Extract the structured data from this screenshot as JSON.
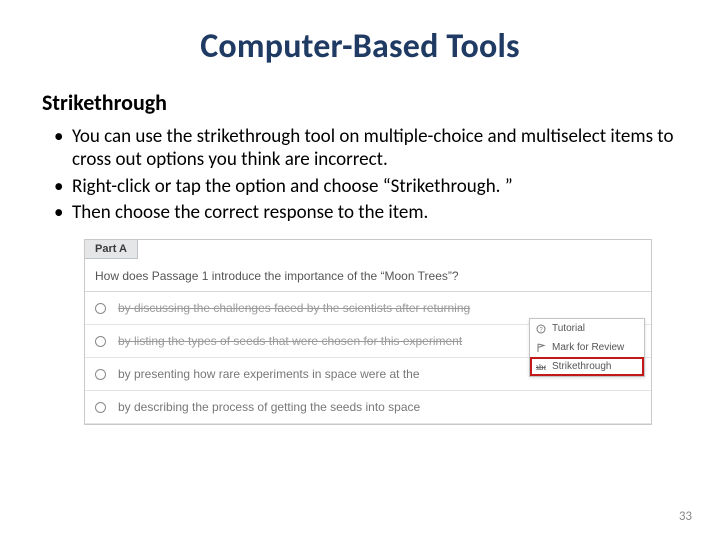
{
  "title": "Computer-Based Tools",
  "subtitle": "Strikethrough",
  "bullets": [
    "You can use the strikethrough tool on multiple-choice and multiselect items to cross out options you think are incorrect.",
    "Right-click or tap the option and choose “Strikethrough. ”",
    "Then choose the correct response to the item."
  ],
  "figure": {
    "part_label": "Part A",
    "question": "How does Passage 1 introduce the importance of the “Moon Trees”?",
    "choices": [
      {
        "text": "by discussing the challenges faced by the scientists after returning",
        "struck": true
      },
      {
        "text": "by listing the types of seeds that were chosen for this experiment",
        "struck": true
      },
      {
        "text": "by presenting how rare experiments in space were at the",
        "struck": false
      },
      {
        "text": "by describing the process of getting the seeds into space",
        "struck": false
      }
    ],
    "menu": {
      "tutorial": "Tutorial",
      "mark": "Mark for Review",
      "strike": "Strikethrough"
    }
  },
  "page_number": "33"
}
